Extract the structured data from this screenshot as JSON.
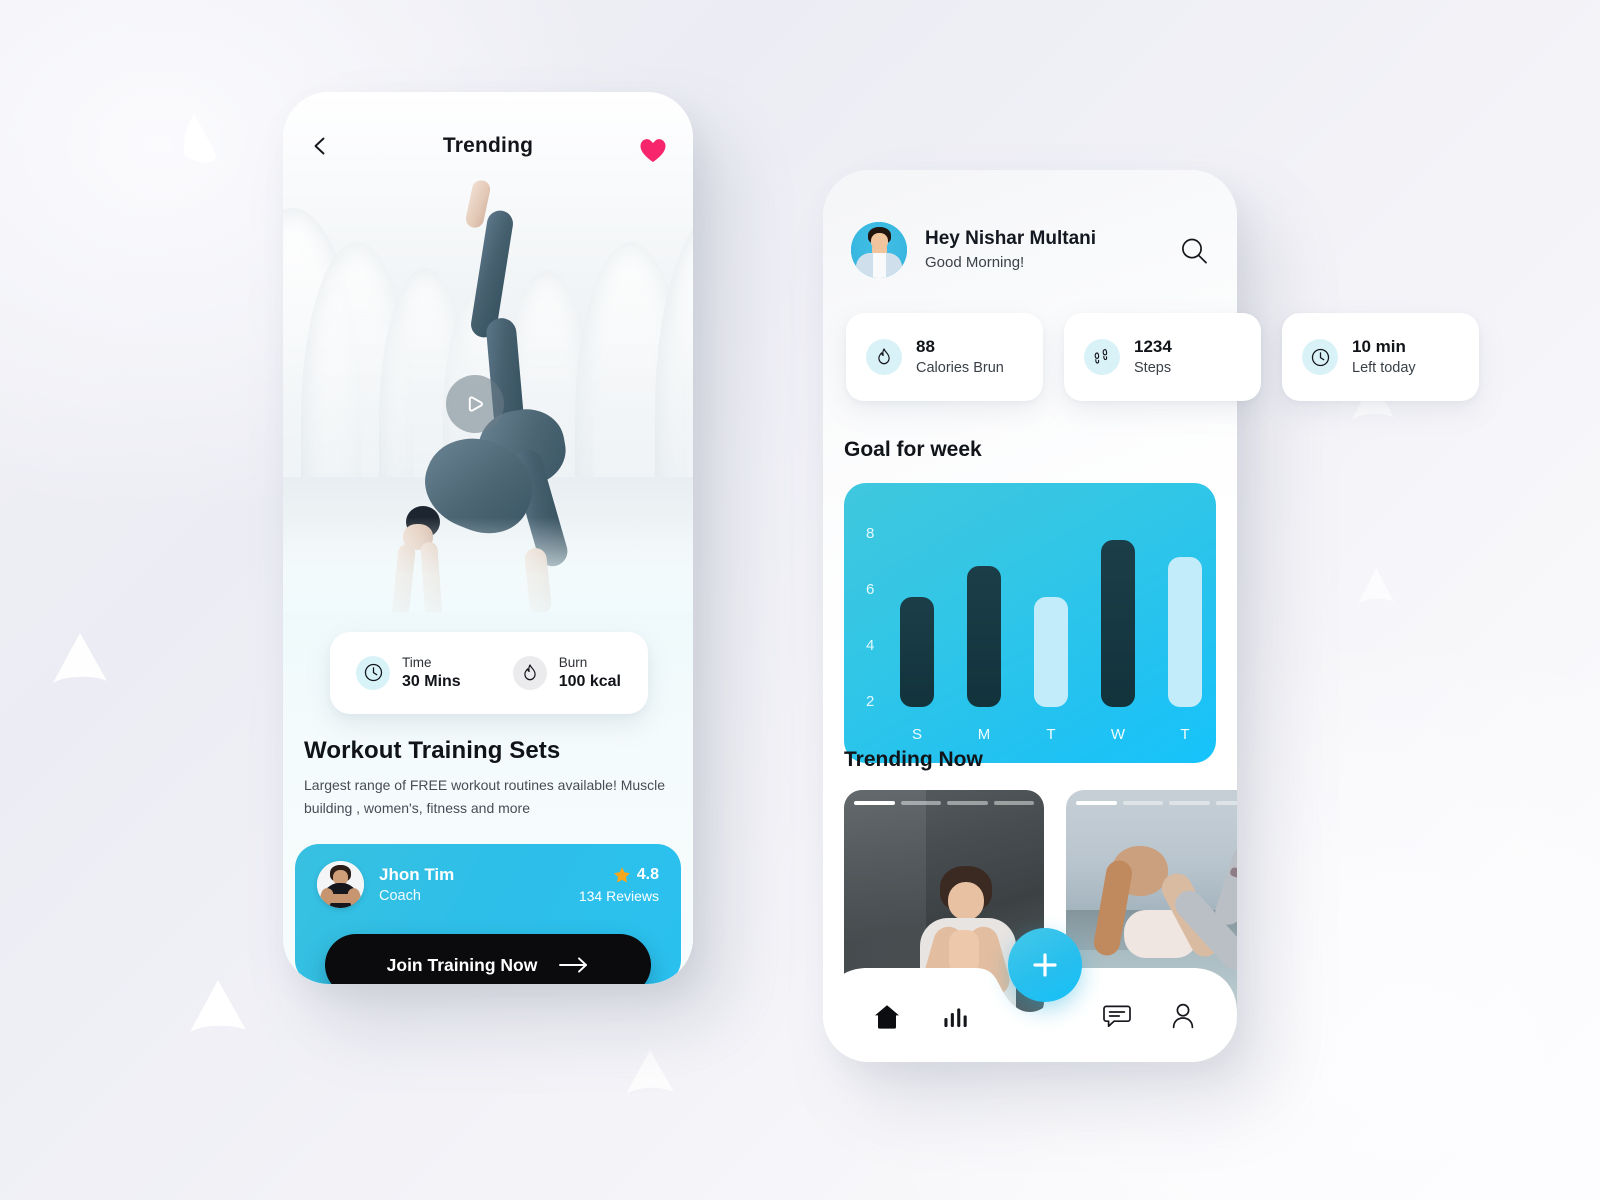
{
  "theme": {
    "accent_cyan": "#25c0ee",
    "accent_dark": "#12333c",
    "bar_light": "#c2ecfa",
    "heart_pink": "#f7256c",
    "star_gold": "#f6a71c",
    "button_black": "#0b0b0d",
    "page_bg": "#f1f2f6"
  },
  "left_phone": {
    "topbar": {
      "back_icon": "chevron-left-icon",
      "title": "Trending",
      "favorite_icon": "heart-filled-icon"
    },
    "hero": {
      "play_icon": "play-icon",
      "alt": "woman performing a backbend yoga pose in a white arched corridor"
    },
    "stats": [
      {
        "icon": "clock-icon",
        "label": "Time",
        "value": "30 Mins",
        "icon_bg": "cyan"
      },
      {
        "icon": "flame-icon",
        "label": "Burn",
        "value": "100 kcal",
        "icon_bg": "gray"
      }
    ],
    "heading": "Workout Training Sets",
    "description": "Largest range of FREE workout routines available! Muscle building , women's, fitness and more",
    "coach": {
      "avatar_alt": "coach portrait",
      "name": "Jhon Tim",
      "role": "Coach",
      "star_icon": "star-filled-icon",
      "rating": "4.8",
      "reviews": "134 Reviews",
      "cta_label": "Join Training Now",
      "cta_icon": "arrow-right-icon"
    }
  },
  "right_phone": {
    "header": {
      "avatar_alt": "user profile photo",
      "greeting_name": "Hey Nishar Multani",
      "greeting_sub": "Good Morning!",
      "search_icon": "search-icon"
    },
    "mini_cards": [
      {
        "icon": "flame-icon",
        "value": "88",
        "label": "Calories Brun"
      },
      {
        "icon": "footsteps-icon",
        "value": "1234",
        "label": "Steps"
      },
      {
        "icon": "clock-icon",
        "value": "10 min",
        "label": "Left today"
      }
    ],
    "goal_title": "Goal for week",
    "trending_title": "Trending Now",
    "trending_cards": [
      {
        "alt": "woman meditating with hands in prayer against a dark stone wall",
        "segments": 4,
        "active_segment": 1
      },
      {
        "alt": "woman doing a bow yoga pose outdoors at sunrise",
        "segments": 4,
        "active_segment": 1
      }
    ],
    "fab": {
      "icon": "plus-icon"
    },
    "nav": [
      {
        "icon": "home-icon",
        "active": true
      },
      {
        "icon": "bar-chart-icon",
        "active": false
      },
      {
        "icon": "chat-icon",
        "active": false
      },
      {
        "icon": "person-icon",
        "active": false
      }
    ]
  },
  "chart_data": {
    "type": "bar",
    "title": "Goal for week",
    "categories": [
      "S",
      "M",
      "T",
      "W",
      "T"
    ],
    "values": [
      5.0,
      6.4,
      5.0,
      7.6,
      6.8
    ],
    "bar_colors": [
      "dark",
      "dark",
      "light",
      "dark",
      "light"
    ],
    "ytick_labels": [
      "8",
      "6",
      "4",
      "2"
    ],
    "yticks": [
      8,
      6,
      4,
      2
    ],
    "ylim": [
      0,
      9
    ],
    "xlabel": "",
    "ylabel": "",
    "grid": false,
    "legend": false
  }
}
